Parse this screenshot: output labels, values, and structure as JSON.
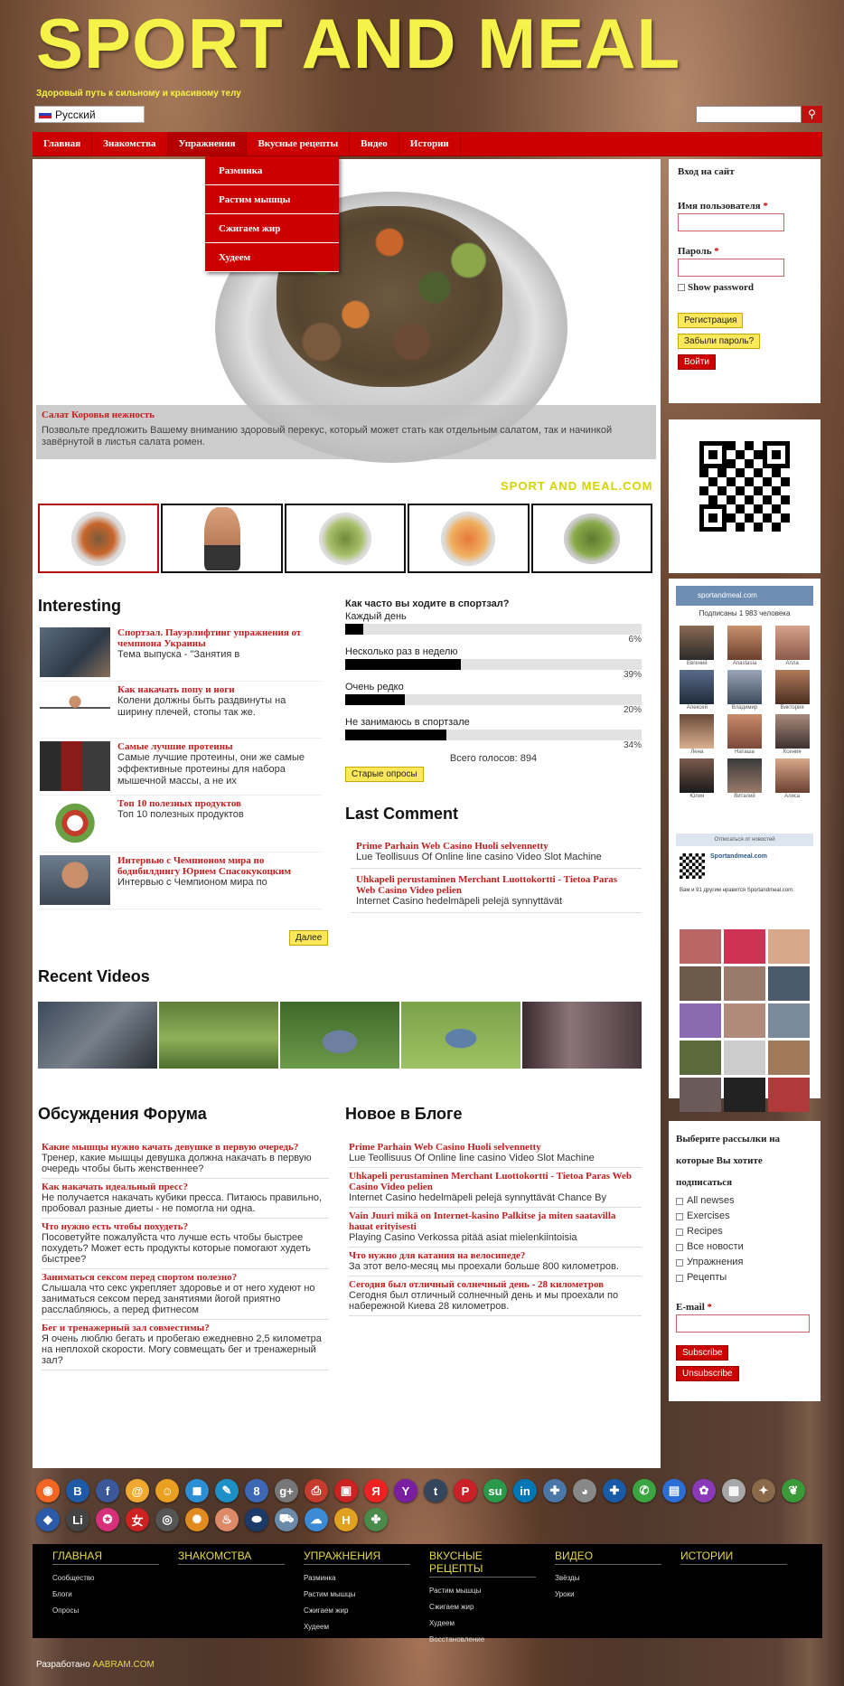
{
  "site": {
    "title": "SPORT AND MEAL",
    "tagline": "Здоровый путь к сильному и красивому телу",
    "language": "Русский"
  },
  "nav": {
    "items": [
      {
        "label": "Главная"
      },
      {
        "label": "Знакомства"
      },
      {
        "label": "Упражнения"
      },
      {
        "label": "Вкусные рецепты"
      },
      {
        "label": "Видео"
      },
      {
        "label": "Истории"
      }
    ],
    "dropdown": [
      {
        "label": "Разминка"
      },
      {
        "label": "Растим мышцы"
      },
      {
        "label": "Сжигаем жир"
      },
      {
        "label": "Худеем"
      }
    ]
  },
  "slider": {
    "title": "Салат Коровья нежность",
    "text": "Позвольте предложить Вашему вниманию здоровый перекус, который может стать как отдельным салатом, так и начинкой завёрнутой в листья салата ромен.",
    "watermark": "SPORT AND MEAL.COM"
  },
  "interesting": {
    "heading": "Interesting",
    "more": "Далее",
    "items": [
      {
        "title": "Спортзал. Пауэрлифтинг упражнения от чемпиона Украины",
        "text": "Тема выпуска - \"Занятия в"
      },
      {
        "title": "Как накачать попу и ноги",
        "text": "Колени должны быть раздвинуты на ширину плечей, стопы так же."
      },
      {
        "title": "Самые лучшие протеины",
        "text": "Самые лучшие протеины, они же самые эффективные протеины для набора мышечной массы, а не их"
      },
      {
        "title": "Топ 10 полезных продуктов",
        "text": "Топ 10 полезных продуктов"
      },
      {
        "title": "Интервью с Чемпионом мира по бодибилдингу Юрием Спасокукоцким",
        "text": "Интервью с Чемпионом мира по"
      }
    ]
  },
  "poll": {
    "question": "Как часто вы ходите в спортзал?",
    "options": [
      {
        "label": "Каждый день",
        "pct_text": "6%",
        "pct": 6
      },
      {
        "label": "Несколько раз в неделю",
        "pct_text": "39%",
        "pct": 39
      },
      {
        "label": "Очень редко",
        "pct_text": "20%",
        "pct": 20
      },
      {
        "label": "Не занимаюсь в спортзале",
        "pct_text": "34%",
        "pct": 34
      }
    ],
    "total": "Всего голосов: 894",
    "old_polls": "Старые опросы"
  },
  "last_comment": {
    "heading": "Last Comment",
    "items": [
      {
        "title": "Prime Parhain Web Casino Huoli selvennetty",
        "text": "Lue Teollisuus Of Online line casino Video Slot Machine"
      },
      {
        "title": "Uhkapeli perustaminen Merchant Luottokortti - Tietoa Paras Web Casino Video pelien",
        "text": "Internet Casino hedelmäpeli pelejä synnyttävät"
      }
    ]
  },
  "videos": {
    "heading": "Recent Videos"
  },
  "forum": {
    "heading": "Обсуждения Форума",
    "items": [
      {
        "title": "Какие мышцы нужно качать девушке в первую очередь?",
        "text": "Тренер, какие мышцы девушка должна накачать в первую очередь чтобы быть женственнее?"
      },
      {
        "title": "Как накачать идеальный пресс?",
        "text": "Не получается накачать кубики пресса. Питаюсь правильно, пробовал разные диеты - не помогла ни одна."
      },
      {
        "title": "Что нужно есть чтобы похудеть?",
        "text": "Посоветуйте пожалуйста что лучше есть чтобы быстрее похудеть? Может есть продукты которые помогают худеть быстрее?"
      },
      {
        "title": "Заниматься сексом перед спортом полезно?",
        "text": "Слышала что секс укрепляет здоровье и от него худеют но заниматься сексом перед занятиями йогой приятно расслабляюсь, а перед фитнесом"
      },
      {
        "title": "Бег и тренажерный зал совместимы?",
        "text": "Я очень люблю бегать и пробегаю ежедневно 2,5 километра на неплохой скорости. Могу совмещать бег и тренажерный зал?"
      }
    ]
  },
  "blog": {
    "heading": "Новое в Блоге",
    "items": [
      {
        "title": "Prime Parhain Web Casino Huoli selvennetty",
        "text": "Lue Teollisuus Of Online line casino Video Slot Machine"
      },
      {
        "title": "Uhkapeli perustaminen Merchant Luottokortti - Tietoa Paras Web Casino Video pelien",
        "text": "Internet Casino hedelmäpeli pelejä synnyttävät Chance By"
      },
      {
        "title": "Vain Juuri mikä on Internet-kasino Palkitse ja miten saatavilla hauat erityisesti",
        "text": "Playing Casino Verkossa pitää asiat mielenkiintoisia"
      },
      {
        "title": "Что нужно для катания на велосипеде?",
        "text": "За этот вело-месяц мы проехали больше 800 километров."
      },
      {
        "title": "Сегодня был отличный солнечный день - 28 километров",
        "text": "Сегодня был отличный солнечный день и мы проехали по набережной Киева 28 километров."
      }
    ]
  },
  "login": {
    "heading": "Вход на сайт",
    "username_label": "Имя пользователя",
    "password_label": "Пароль",
    "required": "*",
    "show_password": "Show password",
    "register": "Регистрация",
    "forgot": "Забыли пароль?",
    "login": "Войти"
  },
  "vk": {
    "group": "sportandmeal.com",
    "members": "Подписаны 1 983 человека",
    "names": [
      "Евгений",
      "Anastasia",
      "Алла",
      "Алексей",
      "Владимир",
      "Виктория",
      "Лена",
      "Наташа",
      "Ксения",
      "Юлия",
      "Виталий",
      "Алиса"
    ],
    "link": "Отписаться от новостей",
    "widget_title": "Sportandmeal.com",
    "widget_note": "Вам и 91 другим нравится Sportandmeal.com."
  },
  "subscribe": {
    "heading": "Выберите рассылки на которые Вы хотите подписаться",
    "options": [
      "All newses",
      "Exercises",
      "Recipes",
      "Все новости",
      "Упражнения",
      "Рецепты"
    ],
    "email_label": "E-mail",
    "subscribe": "Subscribe",
    "unsubscribe": "Unsubscribe"
  },
  "footer": {
    "columns": [
      {
        "title": "ГЛАВНАЯ",
        "links": [
          "Сообщество",
          "Блоги",
          "Опросы"
        ]
      },
      {
        "title": "ЗНАКОМСТВА",
        "links": []
      },
      {
        "title": "УПРАЖНЕНИЯ",
        "links": [
          "Разминка",
          "Растим мышцы",
          "Сжигаем жир",
          "Худеем"
        ]
      },
      {
        "title": "ВКУСНЫЕ РЕЦЕПТЫ",
        "links": [
          "Растим мышцы",
          "Сжигаем жир",
          "Худеем",
          "Восстановление"
        ]
      },
      {
        "title": "ВИДЕО",
        "links": [
          "Звёзды",
          "Уроки"
        ]
      },
      {
        "title": "ИСТОРИИ",
        "links": []
      }
    ],
    "credit_prefix": "Разработано",
    "credit_link": "AABRAM.COM"
  },
  "colors": {
    "accent": "#cc0000",
    "logo": "#f5f24a",
    "link": "#c21f1f"
  }
}
